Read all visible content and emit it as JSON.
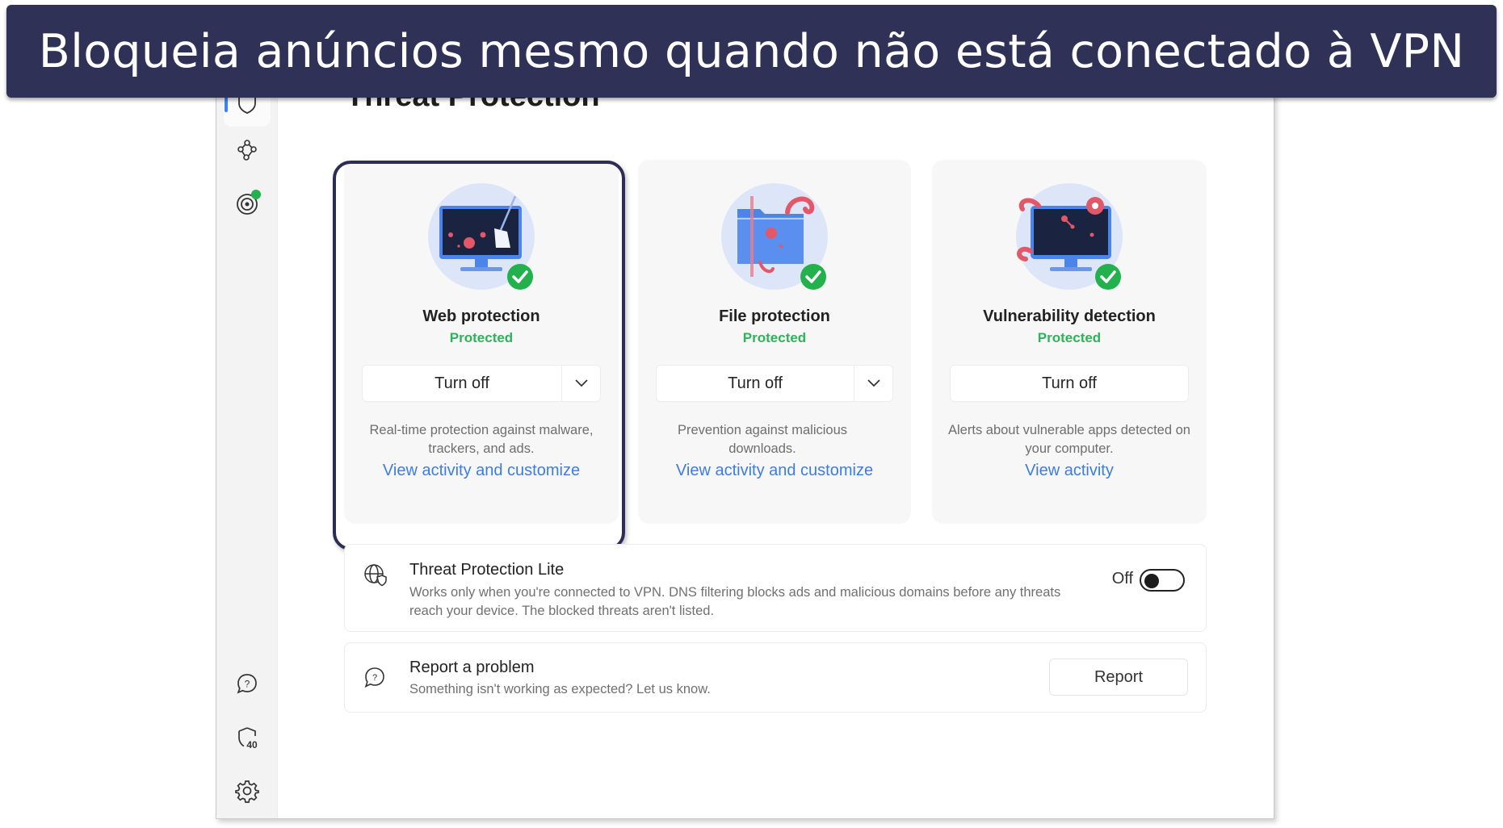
{
  "banner": {
    "text": "Bloqueia anúncios mesmo quando não está conectado à VPN"
  },
  "page": {
    "title": "Threat Protection"
  },
  "sidebar": {
    "items": [
      {
        "name": "threat-protection",
        "icon": "shield-icon",
        "active": true,
        "badge": "green-dot"
      },
      {
        "name": "meshnet",
        "icon": "meshnet-icon",
        "active": false
      },
      {
        "name": "dark-web-monitor",
        "icon": "target-icon",
        "active": false,
        "badge": "green-dot"
      },
      {
        "name": "help",
        "icon": "help-chat-icon",
        "active": false
      },
      {
        "name": "protection-count",
        "icon": "shield-count-icon",
        "count": "40",
        "active": false
      },
      {
        "name": "settings",
        "icon": "gear-icon",
        "active": false
      }
    ]
  },
  "cards": [
    {
      "title": "Web protection",
      "status": "Protected",
      "button": "Turn off",
      "has_dropdown": true,
      "description": "Real-time protection against malware, trackers, and ads.",
      "link": "View activity and customize",
      "illustration": "monitor-broom-icon"
    },
    {
      "title": "File protection",
      "status": "Protected",
      "button": "Turn off",
      "has_dropdown": true,
      "description": "Prevention against malicious downloads.",
      "link": "View activity and customize",
      "illustration": "folder-tentacle-icon"
    },
    {
      "title": "Vulnerability detection",
      "status": "Protected",
      "button": "Turn off",
      "has_dropdown": false,
      "description": "Alerts about vulnerable apps detected on your computer.",
      "link": "View activity",
      "illustration": "monitor-virus-icon"
    }
  ],
  "threat_lite": {
    "title": "Threat Protection Lite",
    "description": "Works only when you're connected to VPN. DNS filtering blocks ads and malicious domains before any threats reach your device. The blocked threats aren't listed.",
    "toggle_label": "Off",
    "toggle_on": false
  },
  "report": {
    "title": "Report a problem",
    "description": "Something isn't working as expected? Let us know.",
    "button": "Report"
  },
  "colors": {
    "banner_bg": "#2f3157",
    "status_green": "#2fb35a",
    "link_blue": "#3b7de0",
    "highlight_border": "#2c2d55",
    "active_indicator": "#3b82f6"
  }
}
